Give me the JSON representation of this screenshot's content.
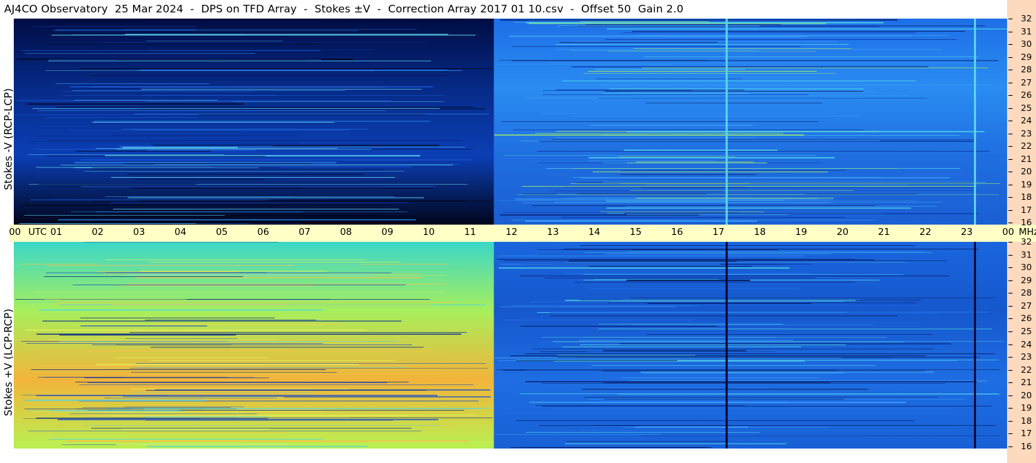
{
  "title": "AJ4CO Observatory  25 Mar 2024  -  DPS on TFD Array  -  Stokes ±V  -  Correction Array 2017 01 10.csv  -  Offset 50  Gain 2.0",
  "chart_data": [
    {
      "type": "heatmap",
      "panel": "top",
      "ylabel": "Stokes -V (RCP-LCP)",
      "y_axis_unit": "MHz",
      "y_range": [
        16,
        32
      ],
      "y_ticks": [
        "32",
        "31",
        "30",
        "29",
        "28",
        "27",
        "26",
        "25",
        "24",
        "23",
        "22",
        "21",
        "20",
        "19",
        "18",
        "17",
        "16"
      ],
      "x_range": [
        0,
        24
      ],
      "colormap": "jet",
      "segments": [
        {
          "x_start": 0,
          "x_end": 11.6,
          "colors": [
            "#000d44",
            "#062a86",
            "#0b3fb5",
            "#00051c"
          ]
        },
        {
          "x_start": 11.6,
          "x_end": 24,
          "colors": [
            "#1e6fe6",
            "#2a8cf2",
            "#1f6ee0",
            "#1a5fd3"
          ]
        }
      ],
      "vertical_lines": [
        {
          "x": 17.2,
          "color": "#5ad4f0"
        },
        {
          "x": 23.2,
          "color": "#5ad4f0"
        }
      ]
    },
    {
      "type": "heatmap",
      "panel": "bottom",
      "ylabel": "Stokes +V (LCP-RCP)",
      "y_axis_unit": "MHz",
      "y_range": [
        16,
        32
      ],
      "y_ticks": [
        "32",
        "31",
        "30",
        "29",
        "28",
        "27",
        "26",
        "25",
        "24",
        "23",
        "22",
        "21",
        "20",
        "19",
        "18",
        "17",
        "16"
      ],
      "x_range": [
        0,
        24
      ],
      "colormap": "jet",
      "segments": [
        {
          "x_start": 0,
          "x_end": 11.6,
          "colors": [
            "#3ad7c8",
            "#a7ef5c",
            "#f2b43a",
            "#b9f052"
          ]
        },
        {
          "x_start": 11.6,
          "x_end": 24,
          "colors": [
            "#1a66de",
            "#1657cc",
            "#1e6de3",
            "#1860d6"
          ]
        }
      ],
      "vertical_lines": [
        {
          "x": 17.2,
          "color": "#000a3a"
        },
        {
          "x": 23.2,
          "color": "#000a3a"
        }
      ]
    }
  ],
  "time_axis": {
    "labels": [
      "00",
      "UTC",
      "01",
      "02",
      "03",
      "04",
      "05",
      "06",
      "07",
      "08",
      "09",
      "10",
      "11",
      "12",
      "13",
      "14",
      "15",
      "16",
      "17",
      "18",
      "19",
      "20",
      "21",
      "22",
      "23",
      "00",
      "MHz"
    ]
  }
}
